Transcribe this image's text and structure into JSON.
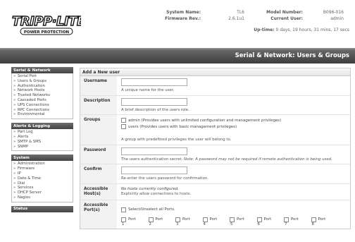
{
  "header": {
    "logo_text": "TRIPP·LITE",
    "logo_sub": "POWER PROTECTION",
    "system_name_label": "System Name:",
    "system_name": "TL6",
    "firmware_label": "Firmware Rev.:",
    "firmware": "2.6.1u1",
    "model_label": "Model Number:",
    "model": "B096-016",
    "user_label": "Current User:",
    "user": "admin",
    "uptime_label": "Up-time:",
    "uptime": "0 days, 19 hours, 31 mins, 17 secs"
  },
  "page_title": "Serial & Network: Users & Groups",
  "sidebar": {
    "groups": [
      {
        "title": "Serial & Network",
        "items": [
          "Serial Port",
          "Users & Groups",
          "Authentication",
          "Network Hosts",
          "Trusted Networks",
          "Cascaded Ports",
          "UPS Connections",
          "RPC Connections",
          "Environmental"
        ]
      },
      {
        "title": "Alerts & Logging",
        "items": [
          "Port Log",
          "Alerts",
          "SMTP & SMS",
          "SNMP"
        ]
      },
      {
        "title": "System",
        "items": [
          "Administration",
          "Firmware",
          "IP",
          "Date & Time",
          "Dial",
          "Services",
          "DHCP Server",
          "Nagios"
        ]
      },
      {
        "title": "Status",
        "items": []
      }
    ]
  },
  "form": {
    "section_title": "Add a New user",
    "username": {
      "label": "Username",
      "value": "",
      "hint": "A unique name for the user."
    },
    "description": {
      "label": "Description",
      "value": "",
      "hint": "A brief description of the users role."
    },
    "groups": {
      "label": "Groups",
      "options": [
        "admin (Provides users with unlimited configuration and management privileges)",
        "users (Provides users with basic management privileges)"
      ],
      "hint": "A group with predefined privileges the user will belong to."
    },
    "password": {
      "label": "Password",
      "value": "",
      "hint_plain": "The users authentication secret.",
      "hint_italic": "Note: A password may not be required if remote authentication is being used."
    },
    "confirm": {
      "label": "Confirm",
      "value": "",
      "hint": "Re-enter the users password for confirmation."
    },
    "accessible_hosts": {
      "label": "Accessible Host(s)",
      "status": "No hosts currently configured.",
      "hint": "Explicitly allow connections to hosts."
    },
    "accessible_ports": {
      "label": "Accessible Port(s)",
      "select_all": "Select/Unselect all Ports.",
      "port_label": "Port",
      "ports": [
        "1",
        "2",
        "3",
        "4",
        "5",
        "6",
        "7",
        "8"
      ]
    }
  }
}
